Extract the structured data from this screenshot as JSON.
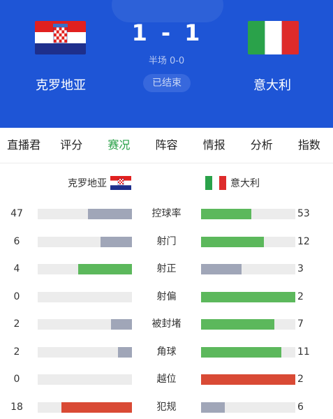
{
  "match": {
    "home_team": "克罗地亚",
    "away_team": "意大利",
    "home_score": "1",
    "separator": "-",
    "away_score": "1",
    "halftime": "半场 0-0",
    "status": "已结束"
  },
  "tabs": [
    {
      "label": "直播君",
      "active": false
    },
    {
      "label": "评分",
      "active": false
    },
    {
      "label": "赛况",
      "active": true
    },
    {
      "label": "阵容",
      "active": false
    },
    {
      "label": "情报",
      "active": false
    },
    {
      "label": "分析",
      "active": false
    },
    {
      "label": "指数",
      "active": false
    }
  ],
  "colors": {
    "header_bg": "#1e55d6",
    "active_tab": "#27a046",
    "green": "#5cb85c",
    "gray": "#a0a6b8",
    "red": "#d94a35",
    "track": "#ececec"
  },
  "stats": [
    {
      "label": "控球率",
      "home": "47",
      "away": "53",
      "home_fill": 0.47,
      "away_fill": 0.53,
      "home_color": "gray",
      "away_color": "green"
    },
    {
      "label": "射门",
      "home": "6",
      "away": "12",
      "home_fill": 0.33,
      "away_fill": 0.67,
      "home_color": "gray",
      "away_color": "green"
    },
    {
      "label": "射正",
      "home": "4",
      "away": "3",
      "home_fill": 0.57,
      "away_fill": 0.43,
      "home_color": "green",
      "away_color": "gray"
    },
    {
      "label": "射偏",
      "home": "0",
      "away": "2",
      "home_fill": 0.0,
      "away_fill": 1.0,
      "home_color": "gray",
      "away_color": "green"
    },
    {
      "label": "被封堵",
      "home": "2",
      "away": "7",
      "home_fill": 0.22,
      "away_fill": 0.78,
      "home_color": "gray",
      "away_color": "green"
    },
    {
      "label": "角球",
      "home": "2",
      "away": "11",
      "home_fill": 0.15,
      "away_fill": 0.85,
      "home_color": "gray",
      "away_color": "green"
    },
    {
      "label": "越位",
      "home": "0",
      "away": "2",
      "home_fill": 0.0,
      "away_fill": 1.0,
      "home_color": "gray",
      "away_color": "red"
    },
    {
      "label": "犯规",
      "home": "18",
      "away": "6",
      "home_fill": 0.75,
      "away_fill": 0.25,
      "home_color": "red",
      "away_color": "gray"
    }
  ]
}
